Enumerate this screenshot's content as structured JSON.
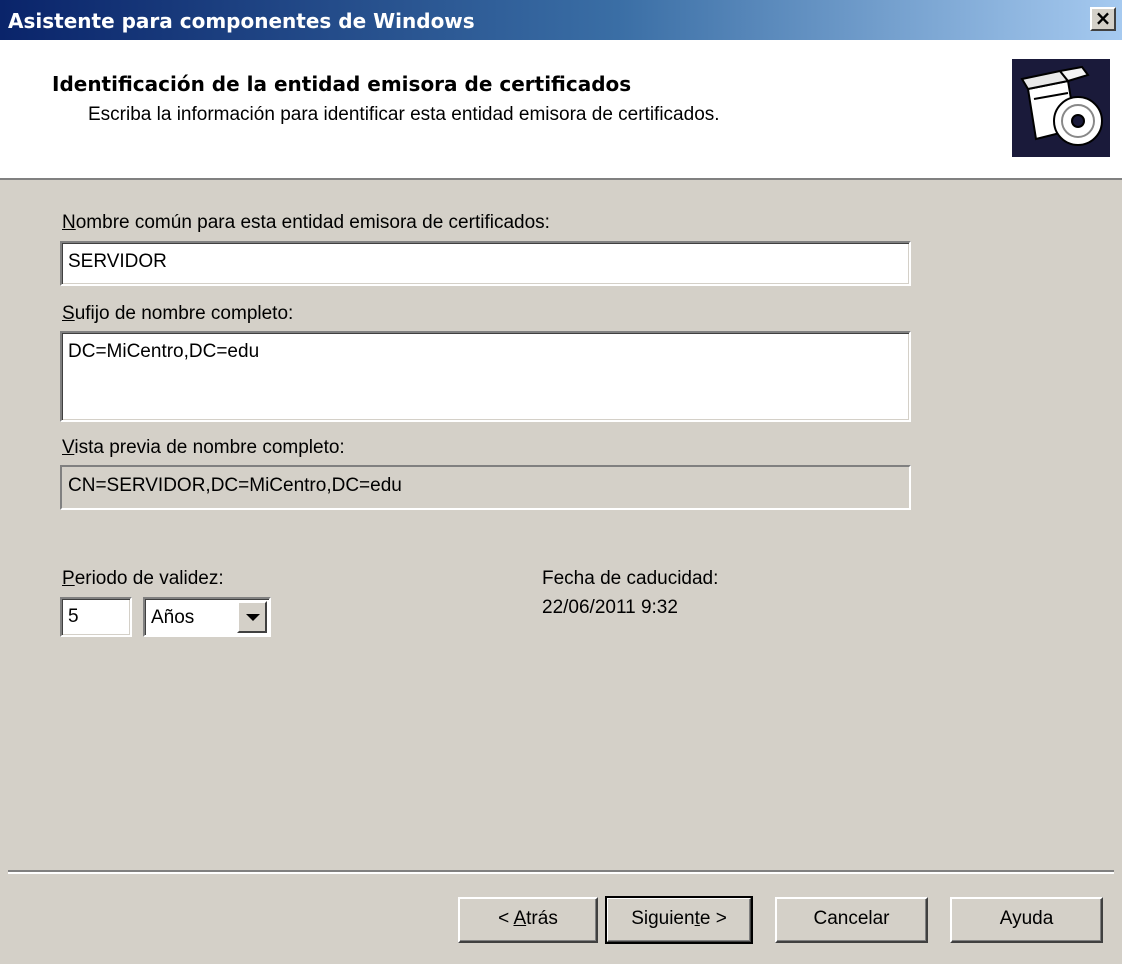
{
  "window": {
    "title": "Asistente para componentes de Windows",
    "close_glyph": "×"
  },
  "header": {
    "title": "Identificación de la entidad emisora de certificados",
    "subtitle": "Escriba la información para identificar esta entidad emisora de certificados.",
    "icon": "software-box-cd-icon"
  },
  "form": {
    "common_name": {
      "label_accel": "N",
      "label_rest": "ombre común para esta entidad emisora de certificados:",
      "value": "SERVIDOR"
    },
    "suffix": {
      "label_accel": "S",
      "label_rest": "ufijo de nombre completo:",
      "value": "DC=MiCentro,DC=edu"
    },
    "preview": {
      "label_accel": "V",
      "label_rest": "ista previa de nombre completo:",
      "value": "CN=SERVIDOR,DC=MiCentro,DC=edu"
    },
    "validity": {
      "label_accel": "P",
      "label_rest": "eriodo de validez:",
      "value": "5",
      "unit": "Años"
    },
    "expiration": {
      "label": "Fecha de caducidad:",
      "value": "22/06/2011 9:32"
    }
  },
  "buttons": {
    "back_prefix": "< ",
    "back_accel": "A",
    "back_rest": "trás",
    "next_prefix": "Siguien",
    "next_accel": "t",
    "next_rest": "e >",
    "cancel": "Cancelar",
    "help": "Ayuda"
  }
}
